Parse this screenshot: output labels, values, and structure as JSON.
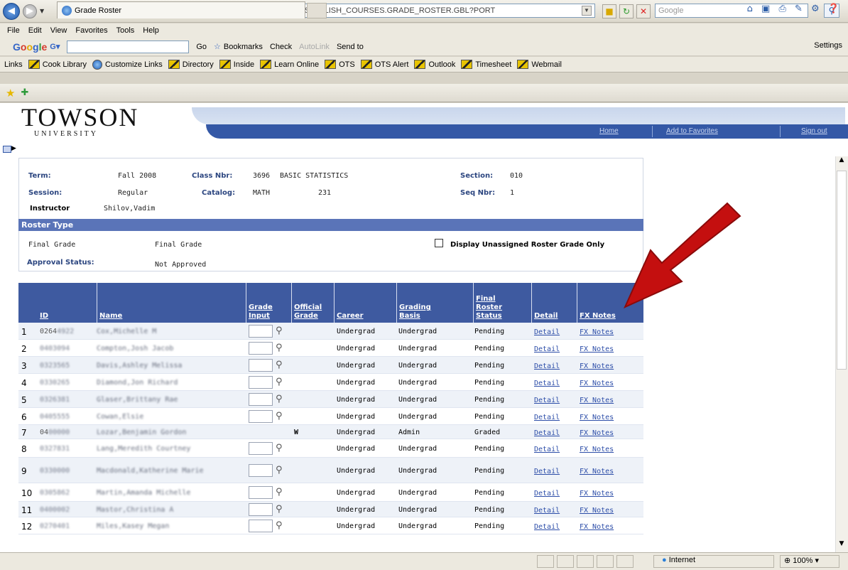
{
  "browser": {
    "url": "https://csprd.towson.edu/psp/CS9PRD/EMPLOYEE/HRMS/c/ESTABLISH_COURSES.GRADE_ROSTER.GBL?PORT",
    "search_placeholder": "Google",
    "menu": [
      "File",
      "Edit",
      "View",
      "Favorites",
      "Tools",
      "Help"
    ],
    "toolbar": {
      "google": "Google",
      "go": "Go",
      "bookmarks": "Bookmarks",
      "check": "Check",
      "autolink": "AutoLink",
      "sendto": "Send to",
      "settings": "Settings"
    },
    "links_label": "Links",
    "links": [
      "Cook Library",
      "Customize Links",
      "Directory",
      "Inside",
      "Learn Online",
      "OTS",
      "OTS Alert",
      "Outlook",
      "Timesheet",
      "Webmail"
    ],
    "tab_title": "Grade Roster",
    "status_zone": "Internet",
    "status_zoom": "100%"
  },
  "header": {
    "logo_main": "TOWSON",
    "logo_sub": "UNIVERSITY",
    "nav": [
      "Home",
      "Add to Favorites",
      "Sign out"
    ]
  },
  "info": {
    "term_label": "Term:",
    "term": "Fall 2008",
    "class_nbr_label": "Class Nbr:",
    "class_nbr": "3696",
    "course_title": "BASIC STATISTICS",
    "section_label": "Section:",
    "section": "010",
    "session_label": "Session:",
    "session": "Regular",
    "catalog_label": "Catalog:",
    "catalog_subject": "MATH",
    "catalog_number": "231",
    "seq_label": "Seq Nbr:",
    "seq": "1",
    "instructor_label": "Instructor",
    "instructor": "Shilov,Vadim"
  },
  "roster": {
    "bar_label": "Roster Type",
    "type_left": "Final Grade",
    "type_value": "Final Grade",
    "display_unassigned_label": "Display Unassigned Roster Grade Only",
    "approval_label": "Approval Status:",
    "approval_value": "Not Approved"
  },
  "grid": {
    "headers": [
      "ID",
      "Name",
      "Grade Input",
      "Official Grade",
      "Career",
      "Grading Basis",
      "Final Roster Status",
      "Detail",
      "FX Notes"
    ],
    "rows": [
      {
        "n": "1",
        "id": "0264",
        "id_hidden": "4922",
        "name": "Cox,Michelle M",
        "grade": "",
        "career": "Undergrad",
        "basis": "Undergrad",
        "status": "Pending",
        "detail": "Detail",
        "fx": "FX Notes"
      },
      {
        "n": "2",
        "id": "",
        "id_hidden": "0403094",
        "name": "Compton,Josh Jacob",
        "grade": "",
        "career": "Undergrad",
        "basis": "Undergrad",
        "status": "Pending",
        "detail": "Detail",
        "fx": "FX Notes"
      },
      {
        "n": "3",
        "id": "",
        "id_hidden": "0323565",
        "name": "Davis,Ashley Melissa",
        "grade": "",
        "career": "Undergrad",
        "basis": "Undergrad",
        "status": "Pending",
        "detail": "Detail",
        "fx": "FX Notes"
      },
      {
        "n": "4",
        "id": "",
        "id_hidden": "0330265",
        "name": "Diamond,Jon Richard",
        "grade": "",
        "career": "Undergrad",
        "basis": "Undergrad",
        "status": "Pending",
        "detail": "Detail",
        "fx": "FX Notes"
      },
      {
        "n": "5",
        "id": "",
        "id_hidden": "0326381",
        "name": "Glaser,Brittany Rae",
        "grade": "",
        "career": "Undergrad",
        "basis": "Undergrad",
        "status": "Pending",
        "detail": "Detail",
        "fx": "FX Notes"
      },
      {
        "n": "6",
        "id": "",
        "id_hidden": "0405555",
        "name": "Cowan,Elsie",
        "grade": "",
        "career": "Undergrad",
        "basis": "Undergrad",
        "status": "Pending",
        "detail": "Detail",
        "fx": "FX Notes"
      },
      {
        "n": "7",
        "id": "04",
        "id_hidden": "00000",
        "name": "Lozar,Benjamin Gordon",
        "grade": "W",
        "career": "Undergrad",
        "basis": "Admin",
        "status": "Graded",
        "detail": "Detail",
        "fx": "FX Notes"
      },
      {
        "n": "8",
        "id": "",
        "id_hidden": "0327831",
        "name": "Lang,Meredith Courtney",
        "grade": "",
        "career": "Undergrad",
        "basis": "Undergrad",
        "status": "Pending",
        "detail": "Detail",
        "fx": "FX Notes"
      },
      {
        "n": "9",
        "id": "",
        "id_hidden": "0330000",
        "name": "Macdonald,Katherine Marie",
        "grade": "",
        "career": "Undergrad",
        "basis": "Undergrad",
        "status": "Pending",
        "detail": "Detail",
        "fx": "FX Notes"
      },
      {
        "n": "10",
        "id": "",
        "id_hidden": "0305862",
        "name": "Martin,Amanda Michelle",
        "grade": "",
        "career": "Undergrad",
        "basis": "Undergrad",
        "status": "Pending",
        "detail": "Detail",
        "fx": "FX Notes"
      },
      {
        "n": "11",
        "id": "",
        "id_hidden": "0400002",
        "name": "Mastor,Christina A",
        "grade": "",
        "career": "Undergrad",
        "basis": "Undergrad",
        "status": "Pending",
        "detail": "Detail",
        "fx": "FX Notes"
      },
      {
        "n": "12",
        "id": "",
        "id_hidden": "0270401",
        "name": "Miles,Kasey Megan",
        "grade": "",
        "career": "Undergrad",
        "basis": "Undergrad",
        "status": "Pending",
        "detail": "Detail",
        "fx": "FX Notes"
      }
    ]
  },
  "colors": {
    "header_blue": "#3e5aa0",
    "roster_bar": "#5a74b8",
    "link_blue": "#2c4da8",
    "arrow_red": "#c40f0f"
  },
  "icons": [
    "back-icon",
    "forward-icon",
    "lock-icon",
    "refresh-icon",
    "stop-icon",
    "search-icon",
    "favorites-star-icon",
    "lookup-magnifier-icon",
    "red-arrow-icon"
  ]
}
